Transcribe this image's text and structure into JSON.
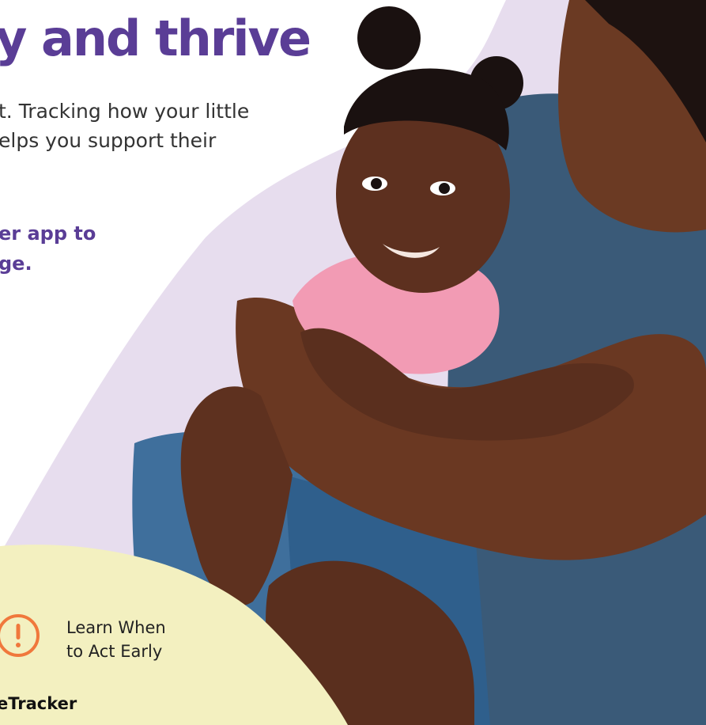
{
  "headline": "y and thrive",
  "body_lines": "t. Tracking how your little\nelps you support their",
  "cta_lines": "er app to\nge.",
  "act_early": {
    "label": "Learn When\nto Act Early",
    "icon": "exclamation-circle-icon"
  },
  "app_name": "eTracker",
  "colors": {
    "purple": "#5a3d96",
    "lavender": "#e7ddee",
    "cream": "#f3f0c0",
    "orange": "#f0783c"
  },
  "photo": {
    "subject": "mother-hugging-smiling-toddler-photo"
  }
}
